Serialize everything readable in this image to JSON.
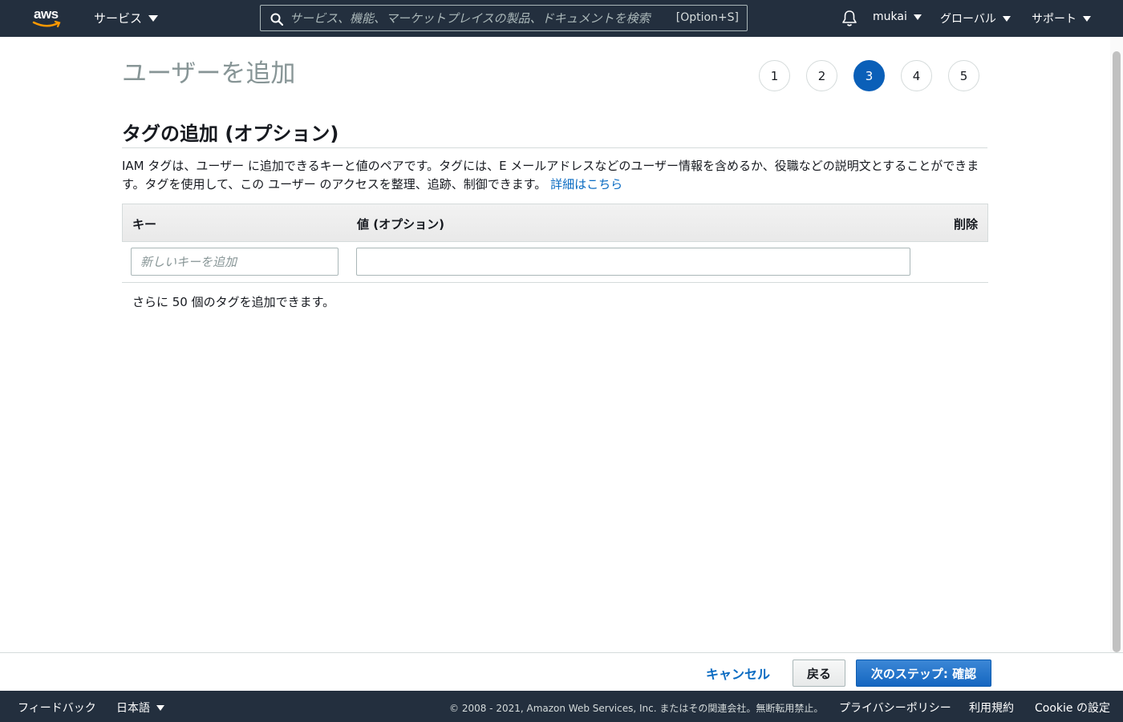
{
  "nav": {
    "logo": "aws",
    "services_label": "サービス",
    "search_placeholder": "サービス、機能、マーケットプレイスの製品、ドキュメントを検索",
    "search_shortcut": "[Option+S]",
    "user_label": "mukai",
    "region_label": "グローバル",
    "support_label": "サポート",
    "icons": [
      "aws-logo",
      "caret-down-icon",
      "search-icon",
      "bell-icon"
    ]
  },
  "page": {
    "title": "ユーザーを追加",
    "steps": [
      "1",
      "2",
      "3",
      "4",
      "5"
    ],
    "active_step": "3"
  },
  "section": {
    "title": "タグの追加 (オプション)",
    "description": "IAM タグは、ユーザー に追加できるキーと値のペアです。タグには、E メールアドレスなどのユーザー情報を含めるか、役職などの説明文とすることができます。タグを使用して、この ユーザー のアクセスを整理、追跡、制御できます。",
    "learn_more": "詳細はこちら"
  },
  "tag_table": {
    "headers": {
      "key": "キー",
      "value": "値 (オプション)",
      "delete": "削除"
    },
    "key_placeholder": "新しいキーを追加",
    "value_current": "",
    "remaining_text": "さらに 50 個のタグを追加できます。"
  },
  "actions": {
    "cancel": "キャンセル",
    "back": "戻る",
    "next": "次のステップ: 確認"
  },
  "footer": {
    "feedback": "フィードバック",
    "language": "日本語",
    "copyright": "© 2008 - 2021, Amazon Web Services, Inc. またはその関連会社。無断転用禁止。",
    "privacy": "プライバシーポリシー",
    "terms": "利用規約",
    "cookie": "Cookie の設定"
  },
  "colors": {
    "nav_bg": "#232f3e",
    "accent_blue": "#0a5fb8",
    "link_blue": "#0a6bc2",
    "title_gray": "#879596"
  }
}
